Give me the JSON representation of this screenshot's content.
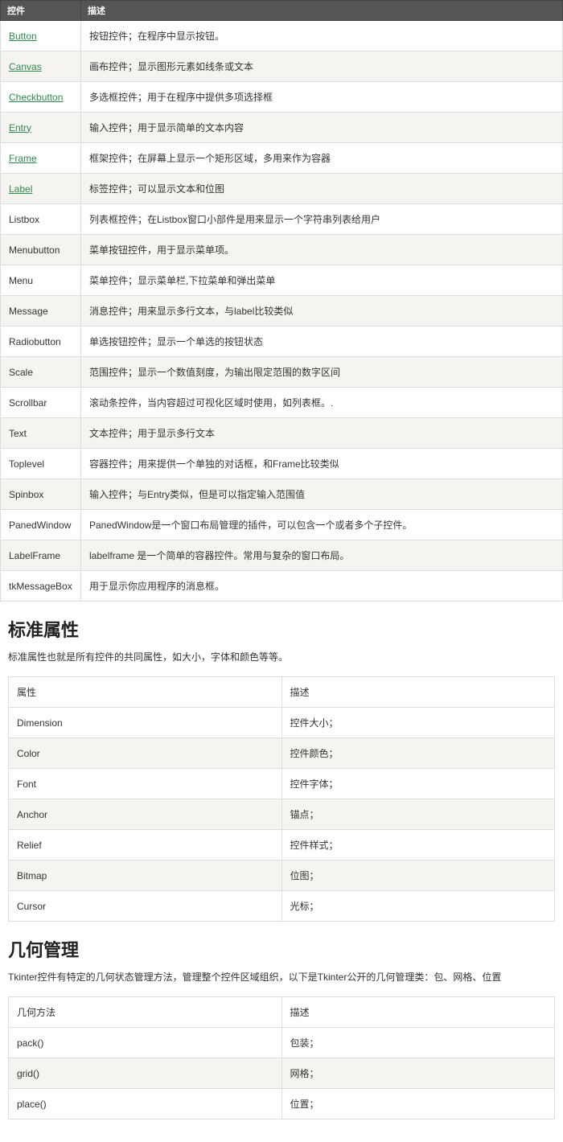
{
  "widgets_table": {
    "headers": [
      "控件",
      "描述"
    ],
    "rows": [
      {
        "name": "Button",
        "link": true,
        "desc": "按钮控件；在程序中显示按钮。"
      },
      {
        "name": "Canvas",
        "link": true,
        "desc": "画布控件；显示图形元素如线条或文本"
      },
      {
        "name": "Checkbutton",
        "link": true,
        "desc": "多选框控件；用于在程序中提供多项选择框"
      },
      {
        "name": "Entry",
        "link": true,
        "desc": "输入控件；用于显示简单的文本内容"
      },
      {
        "name": "Frame",
        "link": true,
        "desc": "框架控件；在屏幕上显示一个矩形区域，多用来作为容器"
      },
      {
        "name": "Label",
        "link": true,
        "desc": "标签控件；可以显示文本和位图"
      },
      {
        "name": "Listbox",
        "link": false,
        "desc": "列表框控件；在Listbox窗口小部件是用来显示一个字符串列表给用户"
      },
      {
        "name": "Menubutton",
        "link": false,
        "desc": "菜单按钮控件，用于显示菜单项。"
      },
      {
        "name": "Menu",
        "link": false,
        "desc": "菜单控件；显示菜单栏,下拉菜单和弹出菜单"
      },
      {
        "name": "Message",
        "link": false,
        "desc": "消息控件；用来显示多行文本，与label比较类似"
      },
      {
        "name": "Radiobutton",
        "link": false,
        "desc": "单选按钮控件；显示一个单选的按钮状态"
      },
      {
        "name": "Scale",
        "link": false,
        "desc": "范围控件；显示一个数值刻度，为输出限定范围的数字区间"
      },
      {
        "name": "Scrollbar",
        "link": false,
        "desc": "滚动条控件，当内容超过可视化区域时使用，如列表框。."
      },
      {
        "name": "Text",
        "link": false,
        "desc": "文本控件；用于显示多行文本"
      },
      {
        "name": "Toplevel",
        "link": false,
        "desc": "容器控件；用来提供一个单独的对话框，和Frame比较类似"
      },
      {
        "name": "Spinbox",
        "link": false,
        "desc": "输入控件；与Entry类似，但是可以指定输入范围值"
      },
      {
        "name": "PanedWindow",
        "link": false,
        "desc": "PanedWindow是一个窗口布局管理的插件，可以包含一个或者多个子控件。"
      },
      {
        "name": "LabelFrame",
        "link": false,
        "desc": "labelframe 是一个简单的容器控件。常用与复杂的窗口布局。"
      },
      {
        "name": "tkMessageBox",
        "link": false,
        "desc": "用于显示你应用程序的消息框。"
      }
    ]
  },
  "section_attrs": {
    "heading": "标准属性",
    "intro": "标准属性也就是所有控件的共同属性，如大小，字体和颜色等等。",
    "headers": [
      "属性",
      "描述"
    ],
    "rows": [
      {
        "name": "Dimension",
        "desc": "控件大小；"
      },
      {
        "name": "Color",
        "desc": "控件颜色；"
      },
      {
        "name": "Font",
        "desc": "控件字体；"
      },
      {
        "name": "Anchor",
        "desc": "锚点；"
      },
      {
        "name": "Relief",
        "desc": "控件样式；"
      },
      {
        "name": "Bitmap",
        "desc": "位图；"
      },
      {
        "name": "Cursor",
        "desc": "光标；"
      }
    ]
  },
  "section_geom": {
    "heading": "几何管理",
    "intro": "Tkinter控件有特定的几何状态管理方法，管理整个控件区域组织，以下是Tkinter公开的几何管理类：包、网格、位置",
    "headers": [
      "几何方法",
      "描述"
    ],
    "rows": [
      {
        "name": "pack()",
        "desc": "包装；"
      },
      {
        "name": "grid()",
        "desc": "网格；"
      },
      {
        "name": "place()",
        "desc": "位置；"
      }
    ]
  }
}
